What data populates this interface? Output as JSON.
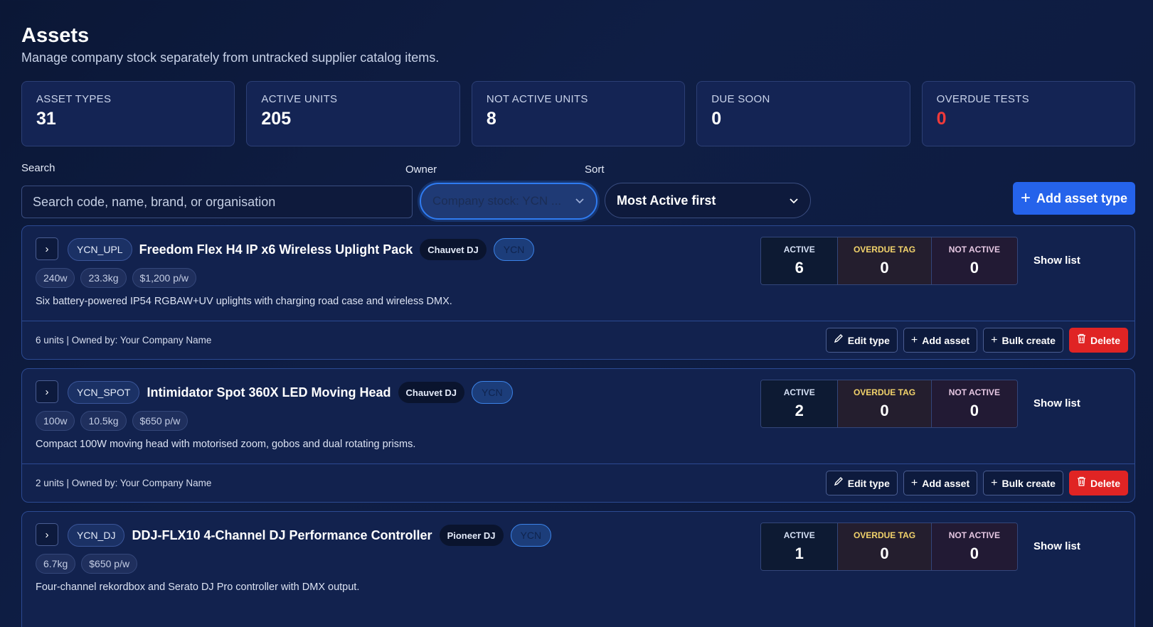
{
  "header": {
    "title": "Assets",
    "subtitle": "Manage company stock separately from untracked supplier catalog items."
  },
  "stats": [
    {
      "label": "ASSET TYPES",
      "value": "31"
    },
    {
      "label": "ACTIVE UNITS",
      "value": "205"
    },
    {
      "label": "NOT ACTIVE UNITS",
      "value": "8"
    },
    {
      "label": "DUE SOON",
      "value": "0"
    },
    {
      "label": "OVERDUE TESTS",
      "value": "0",
      "color": "#ef3a3a"
    }
  ],
  "filters": {
    "search_label": "Search",
    "search_placeholder": "Search code, name, brand, or organisation",
    "owner_label": "Owner",
    "owner_value": "Company stock: YCN ...",
    "sort_label": "Sort",
    "sort_value": "Most Active first",
    "add_button": "Add asset type"
  },
  "status_labels": {
    "active": "ACTIVE",
    "overdue": "OVERDUE TAG",
    "not_active": "NOT ACTIVE"
  },
  "actions": {
    "show_list": "Show list",
    "edit": "Edit type",
    "add": "Add asset",
    "bulk": "Bulk create",
    "delete": "Delete"
  },
  "items": [
    {
      "code": "YCN_UPL",
      "name": "Freedom Flex H4 IP x6 Wireless Uplight Pack",
      "brand": "Chauvet DJ",
      "owner": "YCN",
      "specs": [
        "240w",
        "23.3kg",
        "$1,200 p/w"
      ],
      "description": "Six battery-powered IP54 RGBAW+UV uplights with charging road case and wireless DMX.",
      "active": "6",
      "overdue": "0",
      "not_active": "0",
      "units": "6 units | Owned by: Your Company Name"
    },
    {
      "code": "YCN_SPOT",
      "name": "Intimidator Spot 360X LED Moving Head",
      "brand": "Chauvet DJ",
      "owner": "YCN",
      "specs": [
        "100w",
        "10.5kg",
        "$650 p/w"
      ],
      "description": "Compact 100W moving head with motorised zoom, gobos and dual rotating prisms.",
      "active": "2",
      "overdue": "0",
      "not_active": "0",
      "units": "2 units | Owned by: Your Company Name"
    },
    {
      "code": "YCN_DJ",
      "name": "DDJ-FLX10 4-Channel DJ Performance Controller",
      "brand": "Pioneer DJ",
      "owner": "YCN",
      "specs": [
        "6.7kg",
        "$650 p/w"
      ],
      "description": "Four-channel rekordbox and Serato DJ Pro controller with DMX output.",
      "active": "1",
      "overdue": "0",
      "not_active": "0"
    }
  ]
}
